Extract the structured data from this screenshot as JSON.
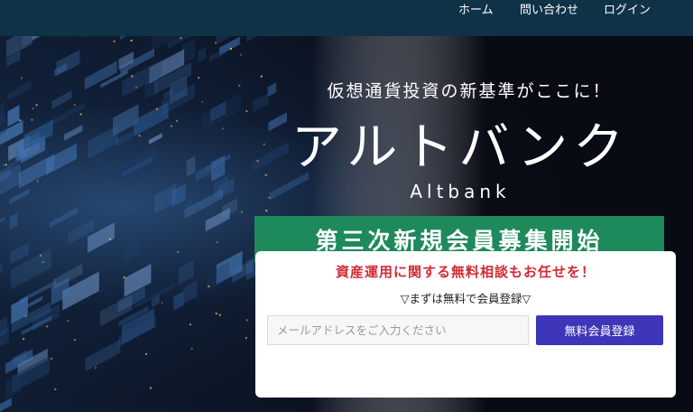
{
  "nav": {
    "home": "ホーム",
    "contact": "問い合わせ",
    "login": "ログイン"
  },
  "hero": {
    "tagline": "仮想通貨投資の新基準がここに！",
    "brand_jp": "アルトバンク",
    "brand_en": "Altbank",
    "banner": "第三次新規会員募集開始"
  },
  "signup": {
    "headline": "資産運用に関する無料相談もお任せを！",
    "subtext": "▽まずは無料で会員登録▽",
    "email_placeholder": "メールアドレスをご入力ください",
    "button_label": "無料会員登録"
  },
  "colors": {
    "topbar": "#103247",
    "banner": "#1e8a5c",
    "headline": "#d22a36",
    "button": "#3e36b9"
  }
}
